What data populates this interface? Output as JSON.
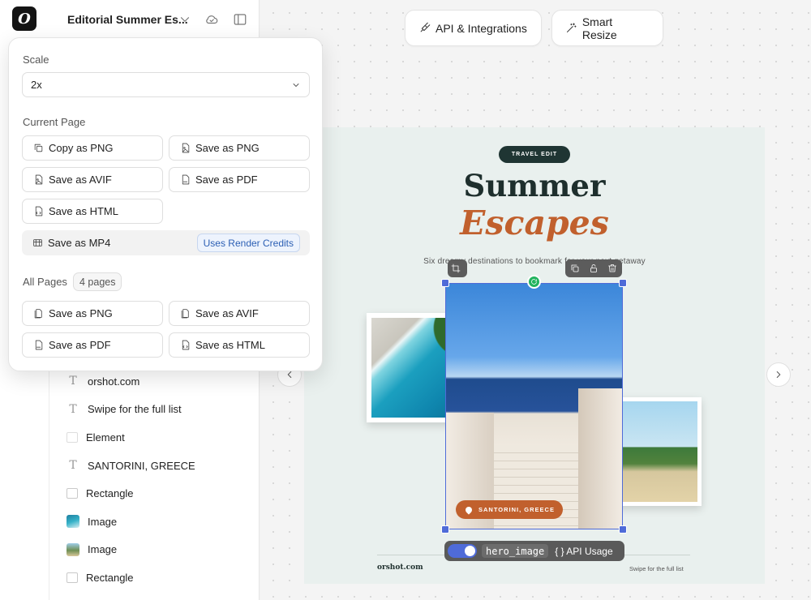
{
  "header": {
    "logo_letter": "O",
    "project_title": "Editorial Summer Es...",
    "icons": [
      "chevron-down-icon",
      "cloud-icon",
      "sidebar-toggle-icon"
    ]
  },
  "layers": [
    {
      "type": "text",
      "label": "orshot.com",
      "icon": "T"
    },
    {
      "type": "text",
      "label": "Swipe for the full list",
      "icon": "T"
    },
    {
      "type": "element",
      "label": "Element",
      "icon": ""
    },
    {
      "type": "text",
      "label": "SANTORINI, GREECE",
      "icon": "T"
    },
    {
      "type": "rectangle",
      "label": "Rectangle",
      "icon": ""
    },
    {
      "type": "image",
      "label": "Image",
      "icon": ""
    },
    {
      "type": "image",
      "label": "Image",
      "icon": ""
    },
    {
      "type": "rectangle",
      "label": "Rectangle",
      "icon": ""
    }
  ],
  "toolbar": {
    "api_integrations": "API & Integrations",
    "smart_resize": "Smart Resize"
  },
  "design": {
    "badge": "TRAVEL EDIT",
    "title_line1": "Summer",
    "title_line2": "Escapes",
    "subtitle": "Six dreamy destinations to bookmark for your next getaway",
    "location_tag": "SANTORINI, GREECE",
    "footer_left": "orshot.com",
    "footer_right": "Swipe for the full list",
    "accent_color": "#c1602d",
    "dark_color": "#1f3533"
  },
  "selection": {
    "layer_name": "hero_image",
    "api_usage_label": "{ } API Usage",
    "selection_color": "#4f6bd8"
  },
  "export_menu": {
    "scale_label": "Scale",
    "scale_value": "2x",
    "current_page_label": "Current Page",
    "current_page_actions": {
      "copy_png": "Copy as PNG",
      "save_png": "Save as PNG",
      "save_avif": "Save as AVIF",
      "save_pdf": "Save as PDF",
      "save_html": "Save as HTML",
      "save_mp4": "Save as MP4"
    },
    "render_credits_badge": "Uses Render Credits",
    "all_pages_label": "All Pages",
    "page_count": "4 pages",
    "all_pages_actions": {
      "save_png": "Save as PNG",
      "save_avif": "Save as AVIF",
      "save_pdf": "Save as PDF",
      "save_html": "Save as HTML"
    },
    "credits_color": "#2c5fb4"
  }
}
